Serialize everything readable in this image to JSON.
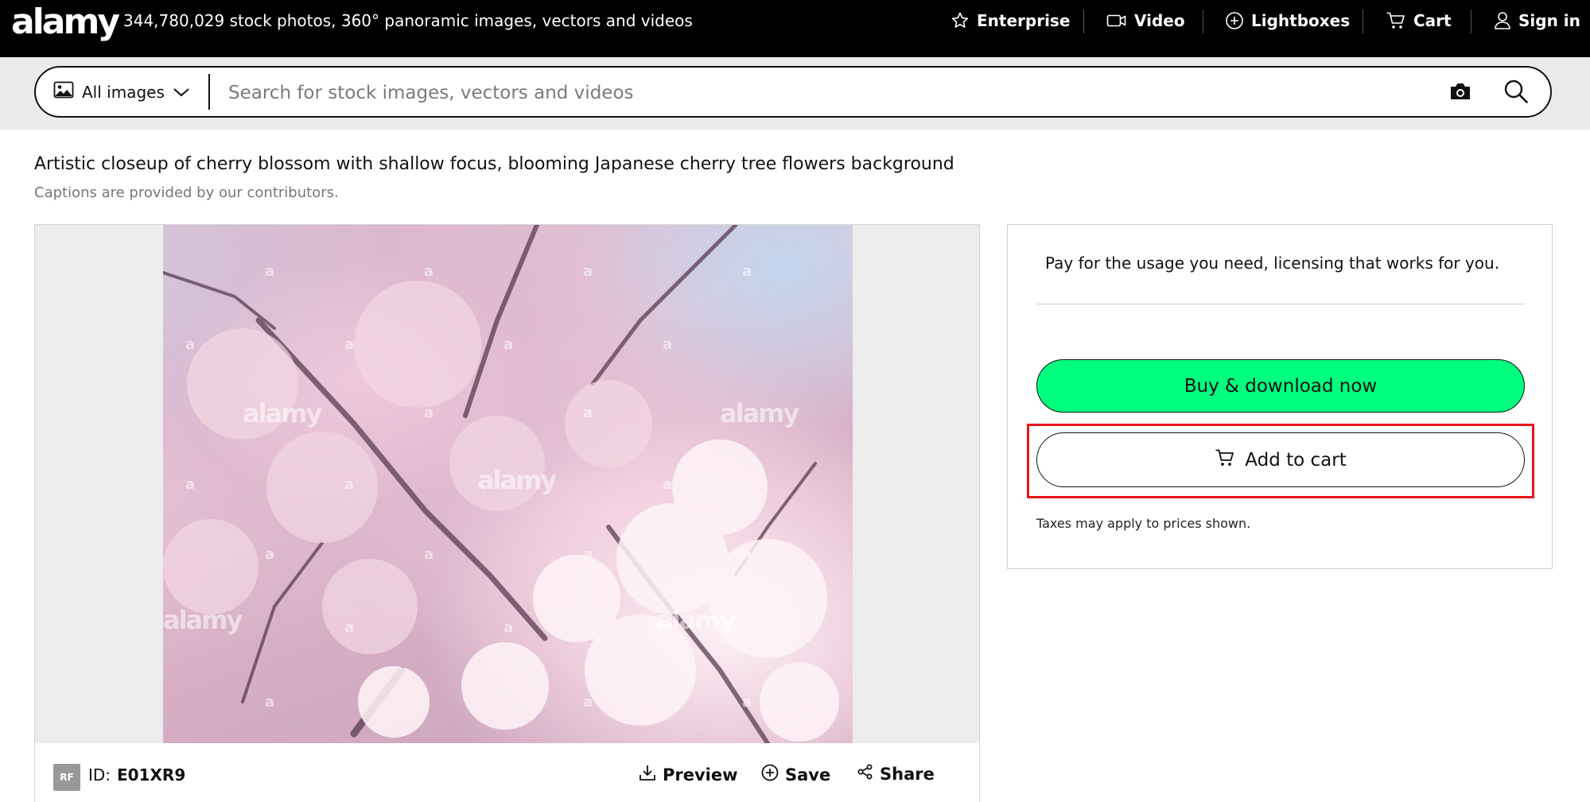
{
  "header": {
    "logo": "alamy",
    "tagline": "344,780,029 stock photos, 360° panoramic images, vectors and videos",
    "nav": {
      "enterprise": "Enterprise",
      "video": "Video",
      "lightboxes": "Lightboxes",
      "cart": "Cart",
      "signin": "Sign in"
    }
  },
  "search": {
    "scope_label": "All images",
    "placeholder": "Search for stock images, vectors and videos",
    "value": ""
  },
  "image": {
    "caption": "Artistic closeup of cherry blossom with shallow focus, blooming Japanese cherry tree flowers background",
    "caption_note": "Captions are provided by our contributors.",
    "watermark_text": "alamy",
    "watermark_letter": "a",
    "license_badge": "RF",
    "id_label": "ID:",
    "id_value": "E01XR9",
    "actions": {
      "preview": "Preview",
      "save": "Save",
      "share": "Share"
    }
  },
  "purchase": {
    "tagline": "Pay for the usage you need, licensing that works for you.",
    "buy_label": "Buy & download now",
    "cart_label": "Add to cart",
    "tax_note": "Taxes may apply to prices shown."
  },
  "colors": {
    "topbar": "#000000",
    "buy_button": "#00ff7f",
    "highlight": "#e8141b"
  }
}
